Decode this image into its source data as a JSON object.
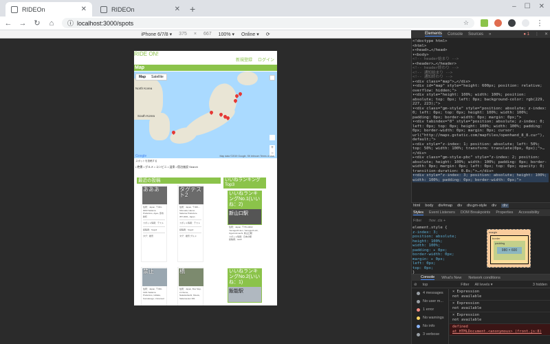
{
  "browser": {
    "tabs": [
      {
        "title": "RIDEOn",
        "active": true
      },
      {
        "title": "RIDEOn",
        "active": false
      }
    ],
    "new_tab": "+",
    "url": "localhost:3000/spots",
    "window": {
      "minimize": "–",
      "maximize": "☐",
      "close": "✕"
    }
  },
  "device_toolbar": {
    "device": "iPhone 6/7/8 ▾",
    "width": "375",
    "times": "×",
    "height": "667",
    "zoom": "100% ▾",
    "network": "Online ▾"
  },
  "page": {
    "brand": "RIDE ON!",
    "links": [
      "新規登録",
      "ログイン"
    ],
    "map_heading": "Map",
    "map_types": [
      "Map",
      "Satellite"
    ],
    "map_labels": [
      "North Korea",
      "South Korea"
    ],
    "zoom": [
      "+",
      "−"
    ],
    "google": "Google",
    "map_credit": "Map data ©2019 Google, SK telecom  Terms of Use",
    "spot_link": "スポットを投稿する",
    "filters": "• 絶景 • グルメ • コンビニ • 温泉 • 宿泊施設 Search",
    "recent_heading": "最近の投稿",
    "ranking_heading": "いいねランキングTop3",
    "cards": [
      {
        "title": "あああ",
        "lines": [
          "住所：Japan, 〒363-0003 Saitama Prefecture, Ageo, 原市新町",
          "スポット情報：テスト",
          "投稿者：hoge2",
          "タグ：絶景"
        ]
      },
      {
        "title": "タグテスト2",
        "lines": [
          "住所：Japan, 〒368-... Shimoda, Hanno Saitama Prefecture 357-0001, Japan",
          "スポット情報：テスト",
          "投稿者：hoge2",
          "タグ：絶景 グルメ"
        ]
      },
      {
        "title": "禁止",
        "lines": [
          "住所：Japan, 〒330-1201 Saitama Prefecture, Hidaka, Komakoogo, Unnamed",
          "",
          "",
          ""
        ]
      },
      {
        "title": "橋",
        "lines": [
          "住所：Japan, Bus Stop, 2-Chome, Nakatsubashi, Kita-ku, Saitama-ken 361",
          "",
          "",
          ""
        ]
      }
    ],
    "ranking": [
      {
        "title": "いいねランキングNo.1(いいね：2)",
        "image_text": "新山口駅",
        "lines": [
          "住所：Japan, 〒754-0002 Yamaguchi-ken, Yamaguchi-shi, Ogoriminmachi, 新山口駅",
          "スポット情報：日本の駅",
          "投稿者：test3"
        ]
      },
      {
        "title": "いいねランキングNo.2(いいね：1)",
        "image_text": "飯能駅",
        "lines": []
      }
    ]
  },
  "devtools": {
    "tabs": [
      "Elements",
      "Console",
      "Sources",
      "»"
    ],
    "error_count": "● 1",
    "dom": [
      "<!doctype html>",
      "<html>",
      " ▸<head>…</head>",
      " ▾<body>",
      "   <!-- header始まり -->",
      "  ▸<header>…</header>",
      "   <!-- header終わり -->",
      "   <!-- 通知始まり -->",
      "   <!-- 通知終わり -->",
      "  ▸<div class=\"map\">…</div>",
      "  ▾<div id=\"map\" style=\"height: 600px; position: relative; overflow: hidden;\">",
      "    ▾<div style=\"height: 100%; width: 100%; position: absolute; top: 0px; left: 0px; background-color: rgb(229, 227, 223);\">",
      "      ▾<div class=\"gm-style\" style=\"position: absolute; z-index: 0; left: 0px; top: 0px; height: 100%; width: 100%; padding: 0px; border-width: 0px; margin: 0px;\">",
      "        ▾<div tabindex=\"0\" style=\"position: absolute; z-index: 0; left: 0px; top: 0px; height: 100%; width: 100%; padding: 0px; border-width: 0px; margin: 0px; cursor: url(\"http://maps.gstatic.com/mapfiles/openhand_8_8.cur\"), default;\">",
      "          ▸<div style=\"z-index: 1; position: absolute; left: 50%; top: 50%; width: 100%; transform: translate(0px, 0px);\">…</div>",
      "          ▸<div class=\"gm-style-pbc\" style=\"z-index: 2; position: absolute; height: 100%; width: 100%; padding: 0px; border-width: 0px; margin: 0px; left: 0px; top: 0px; opacity: 0; transition-duration: 0.8s;\">…</div>",
      "          ▾<div style=\"z-index: 3; position: absolute; height: 100%; width: 100%; padding: 0px; border-width: 0px;\">"
    ],
    "crumbs": [
      "html",
      "body",
      "div#map",
      "div",
      "div.gm-style",
      "div",
      "div"
    ],
    "style_tabs": [
      "Styles",
      "Event Listeners",
      "DOM Breakpoints",
      "Properties",
      "Accessibility"
    ],
    "filter": "Filter",
    "filter_opts": ":hov  .cls  +",
    "style_lines": [
      "element.style {",
      "  z-index: 3;",
      "  position: absolute;",
      "  height: 100%;",
      "  width: 100%;",
      "  padding: ▸ 0px;",
      "  border-width: 0px;",
      "  margin: ▸ 0px;",
      "  left: 0px;",
      "  top: 0px;",
      "}"
    ],
    "box_model": {
      "margin": "margin",
      "border": "border",
      "padding": "padding",
      "content": "980 × 600"
    },
    "console_tabs": [
      "Console",
      "What's New",
      "Network conditions"
    ],
    "console_context": "top",
    "console_filter": "Filter",
    "console_levels": "All levels ▾",
    "console_hidden": "3 hidden",
    "sidebar": [
      {
        "label": "4 messages",
        "color": "#9aa0a6"
      },
      {
        "label": "No user m...",
        "color": "#9aa0a6"
      },
      {
        "label": "1 error",
        "color": "#f28b82"
      },
      {
        "label": "No warnings",
        "color": "#fdd663"
      },
      {
        "label": "No info",
        "color": "#8ab4f8"
      },
      {
        "label": "3 verbose",
        "color": "#9aa0a6"
      }
    ],
    "messages": [
      {
        "text": "× Expression",
        "sub": "not available",
        "error": false
      },
      {
        "text": "× Expression",
        "sub": "not available",
        "error": false
      },
      {
        "text": "× Expression",
        "sub": "not available",
        "error": false
      },
      {
        "text": "defined",
        "sub": "at HTMLDocument.<anonymous> (front.js:8)",
        "error": true
      }
    ]
  },
  "colors": {
    "accent": "#8bc34a",
    "pin": "#e53935"
  }
}
